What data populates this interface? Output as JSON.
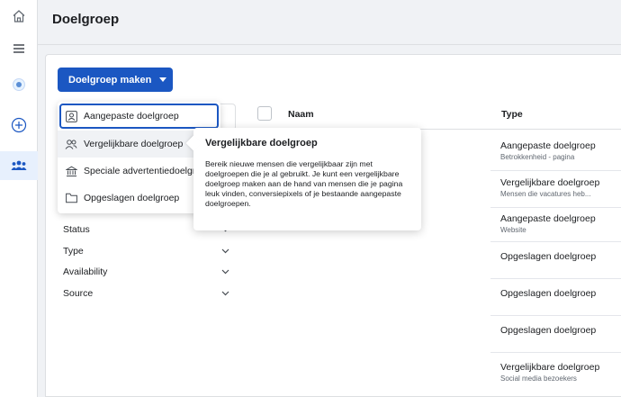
{
  "rail": {
    "icons": [
      "home-icon",
      "menu-icon",
      "account-icon",
      "add-icon",
      "audiences-icon"
    ]
  },
  "header": {
    "title": "Doelgroep"
  },
  "create_button": {
    "label": "Doelgroep maken"
  },
  "dropdown": {
    "items": [
      {
        "label": "Aangepaste doelgroep",
        "icon": "custom-audience-icon"
      },
      {
        "label": "Vergelijkbare doelgroep",
        "icon": "lookalike-audience-icon"
      },
      {
        "label": "Speciale advertentiedoelgroep",
        "icon": "special-audience-icon"
      },
      {
        "label": "Opgeslagen doelgroep",
        "icon": "folder-icon"
      }
    ]
  },
  "tooltip": {
    "title": "Vergelijkbare doelgroep",
    "body": "Bereik nieuwe mensen die vergelijkbaar zijn met doelgroepen die je al gebruikt. Je kunt een vergelijkbare doelgroep maken aan de hand van mensen die je pagina leuk vinden, conversiepixels of je bestaande aangepaste doelgroepen."
  },
  "filters": [
    {
      "label": "Status"
    },
    {
      "label": "Type"
    },
    {
      "label": "Availability"
    },
    {
      "label": "Source"
    }
  ],
  "table": {
    "columns": {
      "name": "Naam",
      "type": "Type"
    },
    "rows": [
      {
        "type": "Aangepaste doelgroep",
        "sub": "Betrokkenheid - pagina"
      },
      {
        "type": "Vergelijkbare doelgroep",
        "sub": "Mensen die vacatures heb..."
      },
      {
        "type": "Aangepaste doelgroep",
        "sub": "Website"
      },
      {
        "type": "Opgeslagen doelgroep",
        "sub": ""
      },
      {
        "type": "Opgeslagen doelgroep",
        "sub": ""
      },
      {
        "type": "Opgeslagen doelgroep",
        "sub": ""
      },
      {
        "type": "Vergelijkbare doelgroep",
        "sub": "Social media bezoekers"
      }
    ]
  },
  "colors": {
    "accent": "#1b57c2",
    "background": "#f0f2f5",
    "border": "#dddfe2"
  }
}
